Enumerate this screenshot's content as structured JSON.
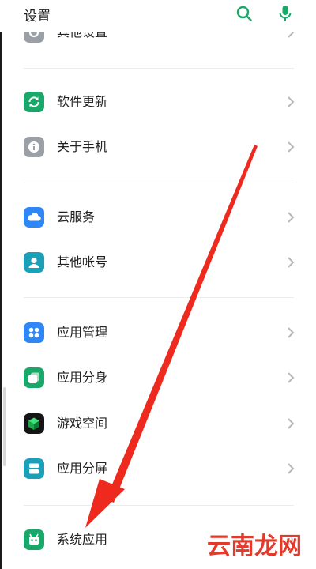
{
  "header": {
    "title": "设置"
  },
  "groups": [
    {
      "items": [
        {
          "label": "其他设置",
          "icon": "settings-icon"
        }
      ]
    },
    {
      "items": [
        {
          "label": "软件更新",
          "icon": "update-icon"
        },
        {
          "label": "关于手机",
          "icon": "info-icon"
        }
      ]
    },
    {
      "items": [
        {
          "label": "云服务",
          "icon": "cloud-icon"
        },
        {
          "label": "其他帐号",
          "icon": "account-icon"
        }
      ]
    },
    {
      "items": [
        {
          "label": "应用管理",
          "icon": "app-grid-icon"
        },
        {
          "label": "应用分身",
          "icon": "app-clone-icon"
        },
        {
          "label": "游戏空间",
          "icon": "game-cube-icon"
        },
        {
          "label": "应用分屏",
          "icon": "split-screen-icon"
        }
      ]
    },
    {
      "items": [
        {
          "label": "系统应用",
          "icon": "system-app-icon"
        }
      ]
    }
  ],
  "colors": {
    "accent_green": "#1aa86a",
    "gray_icon": "#9aa0a6",
    "blue_icon": "#2f86f6",
    "teal_icon": "#1aa0b8",
    "arrow_red": "#ee2a1e"
  },
  "watermark": "云南龙网"
}
